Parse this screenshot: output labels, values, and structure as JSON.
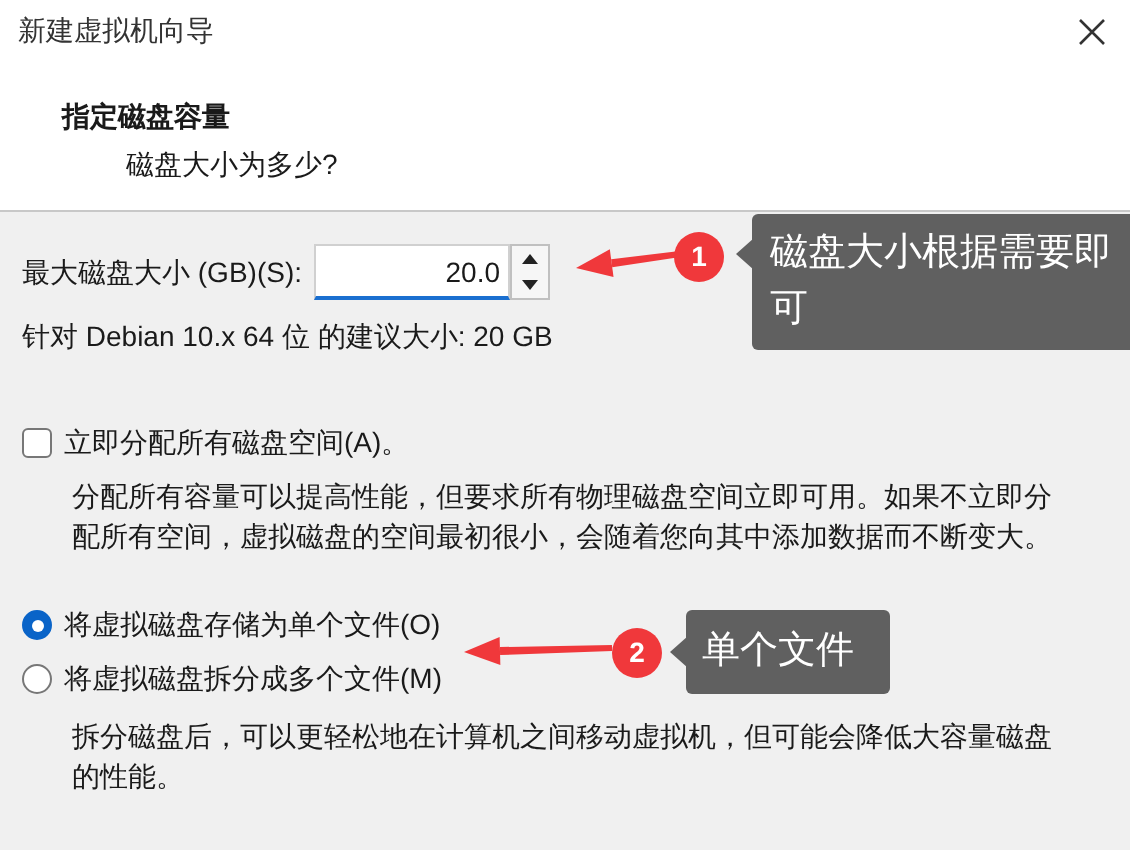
{
  "window": {
    "title": "新建虚拟机向导"
  },
  "header": {
    "title": "指定磁盘容量",
    "subtitle": "磁盘大小为多少?"
  },
  "disk_size": {
    "label": "最大磁盘大小 (GB)(S):",
    "value": "20.0"
  },
  "recommendation": "针对 Debian 10.x 64 位 的建议大小: 20 GB",
  "allocate": {
    "label": "立即分配所有磁盘空间(A)。",
    "checked": false,
    "description": "分配所有容量可以提高性能，但要求所有物理磁盘空间立即可用。如果不立即分配所有空间，虚拟磁盘的空间最初很小，会随着您向其中添加数据而不断变大。"
  },
  "storage_options": [
    {
      "label": "将虚拟磁盘存储为单个文件(O)",
      "selected": true
    },
    {
      "label": "将虚拟磁盘拆分成多个文件(M)",
      "selected": false,
      "description": "拆分磁盘后，可以更轻松地在计算机之间移动虚拟机，但可能会降低大容量磁盘的性能。"
    }
  ],
  "annotations": [
    {
      "number": "1",
      "text": "磁盘大小根据需要即可"
    },
    {
      "number": "2",
      "text": "单个文件"
    }
  ]
}
